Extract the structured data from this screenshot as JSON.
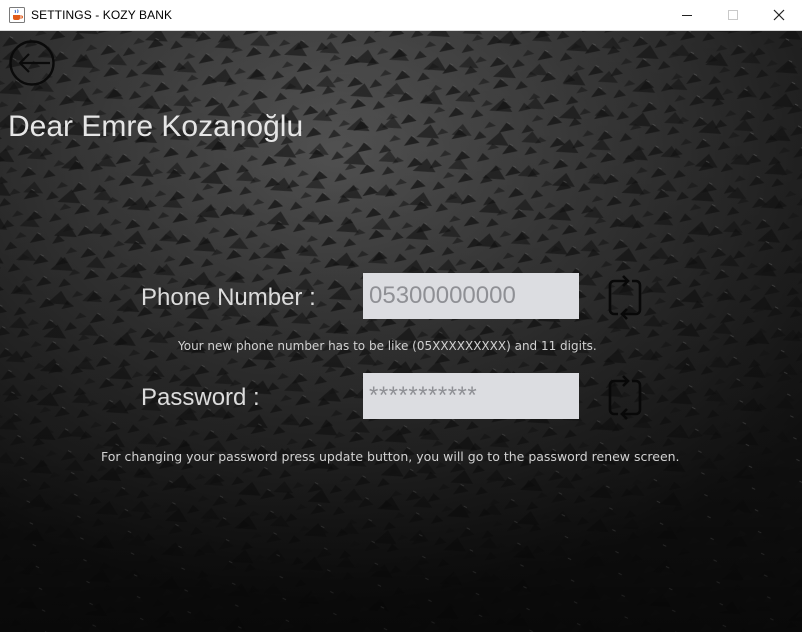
{
  "window": {
    "title": "SETTINGS - KOZY BANK",
    "app_icon": "java-cup-icon",
    "controls": [
      "minimize-icon",
      "maximize-icon",
      "close-icon"
    ]
  },
  "header": {
    "back_icon": "arrow-left-circle-icon",
    "greeting": "Dear Emre Kozanoğlu"
  },
  "form": {
    "phone": {
      "label": "Phone Number :",
      "value": "05300000000",
      "hint": "Your new phone number has to be like (05XXXXXXXXX) and 11 digits.",
      "action_icon": "refresh-icon"
    },
    "password": {
      "label": "Password :",
      "value": "***********",
      "hint": "For changing your password press update button, you will go to the password renew screen.",
      "action_icon": "refresh-icon"
    }
  },
  "colors": {
    "background": "#2a2a2a",
    "text": "#e6e6e6",
    "input_bg": "#dcdde1",
    "input_text": "#8f9095"
  }
}
